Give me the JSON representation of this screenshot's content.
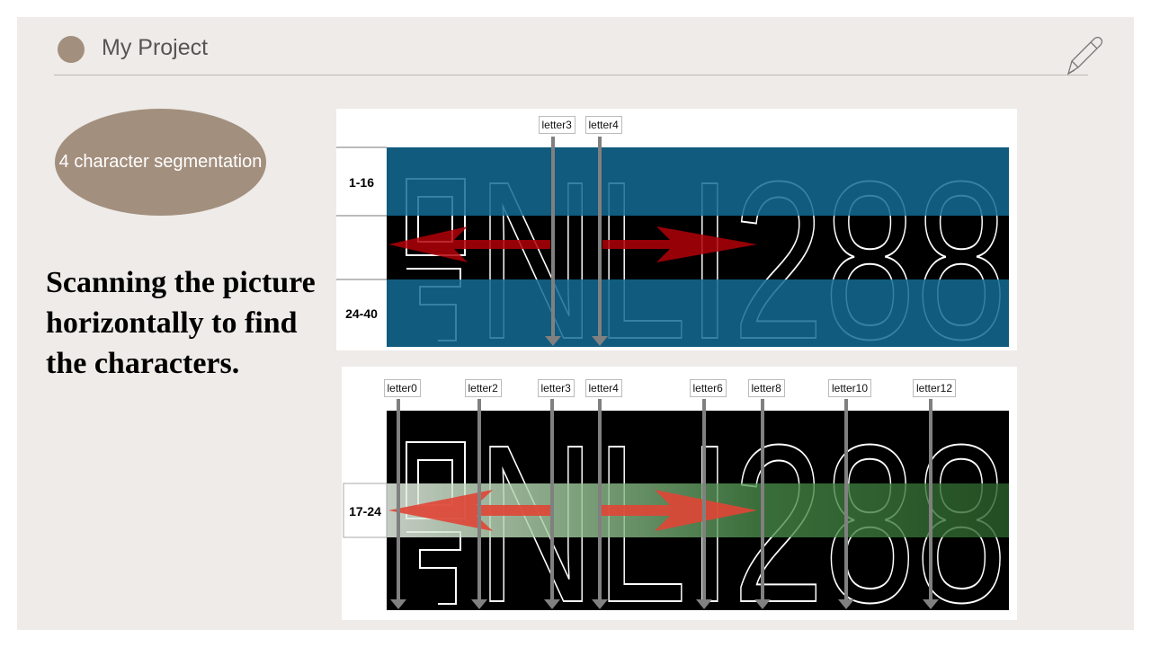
{
  "header": {
    "title": "My Project"
  },
  "badge": {
    "label": "4 character segmentation"
  },
  "body": {
    "text": "Scanning the picture horizontally to find the characters."
  },
  "plate_text": "NLI288",
  "panel_top": {
    "row_labels": [
      "1-16",
      "",
      "24-40"
    ],
    "letters": [
      "letter3",
      "letter4"
    ]
  },
  "panel_bottom": {
    "row_label": "17-24",
    "letters": [
      "letter0",
      "letter2",
      "letter3",
      "letter4",
      "letter6",
      "letter8",
      "letter10",
      "letter12"
    ]
  },
  "colors": {
    "accent": "#a38f7e",
    "band_blue": "#136b94",
    "arrow_red": "#c0000a",
    "band_green": "#2f6f2f"
  },
  "icons": {
    "pen": "pen-icon"
  }
}
